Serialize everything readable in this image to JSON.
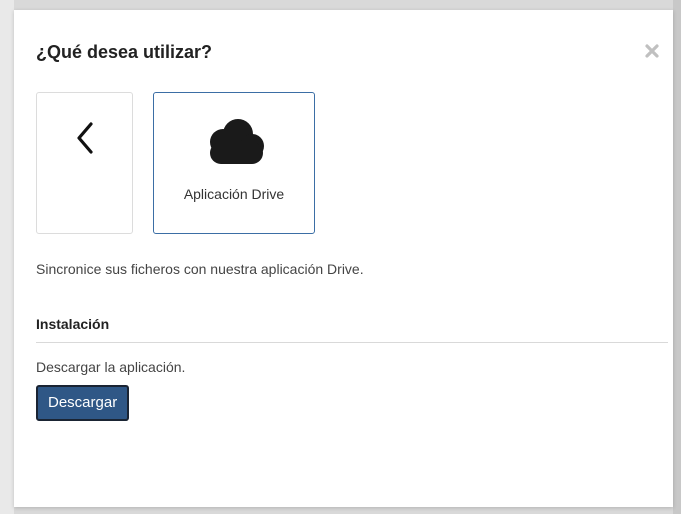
{
  "dialog": {
    "title": "¿Qué desea utilizar?",
    "close_icon": "close-icon"
  },
  "options": [
    {
      "icon": "chevron-left-icon",
      "label": ""
    },
    {
      "icon": "cloud-icon",
      "label": "Aplicación Drive",
      "selected": true
    }
  ],
  "description": "Sincronice sus ficheros con nuestra aplicación Drive.",
  "installation": {
    "heading": "Instalación",
    "text": "Descargar la aplicación.",
    "download_label": "Descargar"
  },
  "colors": {
    "accent": "#2f5786",
    "selected_border": "#3b6ea5"
  }
}
